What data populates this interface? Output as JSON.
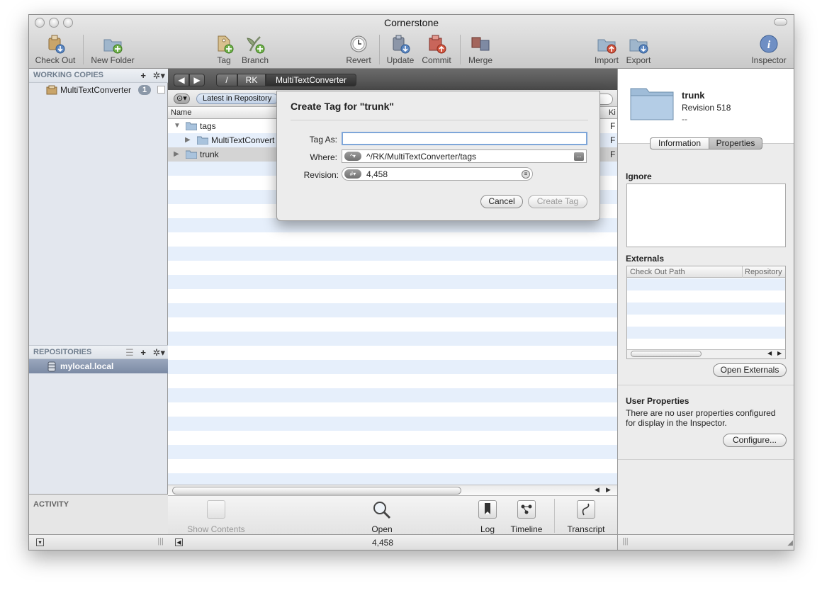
{
  "window": {
    "title": "Cornerstone"
  },
  "toolbar": {
    "check_out": "Check Out",
    "new_folder": "New Folder",
    "tag": "Tag",
    "branch": "Branch",
    "revert": "Revert",
    "update": "Update",
    "commit": "Commit",
    "merge": "Merge",
    "import": "Import",
    "export": "Export",
    "inspector": "Inspector"
  },
  "sidebar": {
    "working_copies_title": "WORKING COPIES",
    "add": "+",
    "gear": "✲▾",
    "working_copy_name": "MultiTextConverter",
    "working_copy_badge": "1",
    "repositories_title": "REPOSITORIES",
    "repositories_list_icon": "☰",
    "repository_name": "mylocal.local",
    "activity_title": "ACTIVITY"
  },
  "pathbar": {
    "back": "◀",
    "forward": "▶",
    "crumbs": [
      "/",
      "RK",
      "MultiTextConverter"
    ]
  },
  "scope": {
    "selector": "⊙▾",
    "value": "Latest in Repository"
  },
  "browser": {
    "column_name": "Name",
    "column_kind": "Ki",
    "rows": [
      {
        "name": "tags",
        "kind": "F"
      },
      {
        "name": "MultiTextConvert",
        "kind": "F"
      },
      {
        "name": "trunk",
        "kind": "F"
      }
    ]
  },
  "actions": {
    "show_contents": "Show Contents",
    "open": "Open",
    "log": "Log",
    "timeline": "Timeline",
    "transcript": "Transcript"
  },
  "status": {
    "revision": "4,458"
  },
  "inspector": {
    "item_name": "trunk",
    "revision_text": "Revision 518",
    "dashes": "--",
    "tab_information": "Information",
    "tab_properties": "Properties",
    "ignore_label": "Ignore",
    "externals_label": "Externals",
    "externals_col_path": "Check Out Path",
    "externals_col_repo": "Repository",
    "open_externals": "Open Externals",
    "user_properties_label": "User Properties",
    "user_properties_text": "There are no user properties configured for display in the Inspector.",
    "configure": "Configure..."
  },
  "dialog": {
    "title": "Create Tag for \"trunk\"",
    "tag_as_label": "Tag As:",
    "tag_as_value": "",
    "where_label": "Where:",
    "where_value": "^/RK/MultiTextConverter/tags",
    "where_popup": "^▾",
    "where_browse": "...",
    "revision_label": "Revision:",
    "revision_popup": "#▾",
    "revision_value": "4,458",
    "cancel": "Cancel",
    "create_tag": "Create Tag"
  }
}
